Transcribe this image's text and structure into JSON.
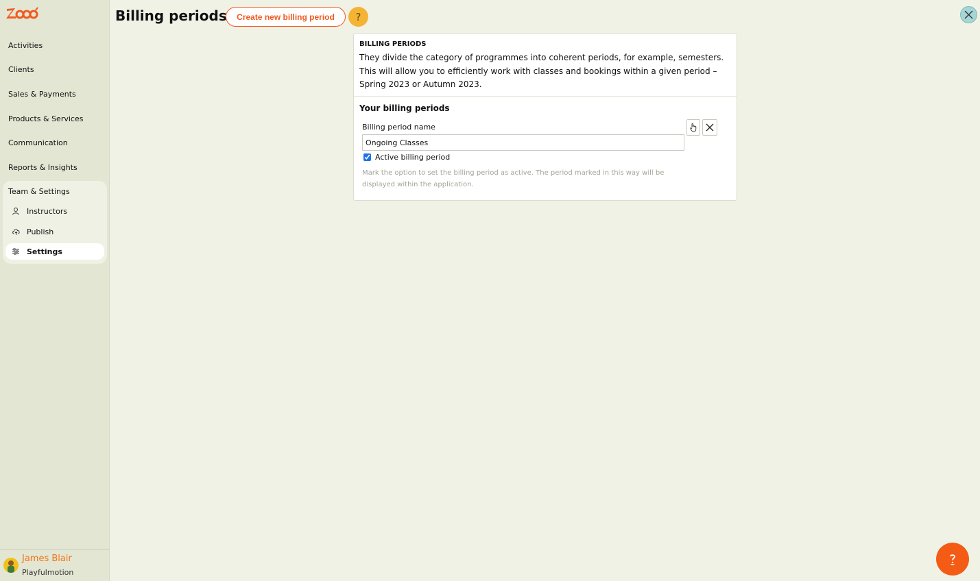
{
  "sidebar": {
    "nav": [
      {
        "label": "Activities"
      },
      {
        "label": "Clients"
      },
      {
        "label": "Sales & Payments"
      },
      {
        "label": "Products & Services"
      },
      {
        "label": "Communication"
      },
      {
        "label": "Reports & Insights"
      }
    ],
    "team": {
      "title": "Team & Settings",
      "items": [
        {
          "label": "Instructors",
          "icon": "user-icon"
        },
        {
          "label": "Publish",
          "icon": "cloud-upload-icon"
        },
        {
          "label": "Settings",
          "icon": "sliders-icon",
          "active": true
        }
      ]
    },
    "user": {
      "name": "James Blair",
      "org": "Playfulmotion"
    }
  },
  "header": {
    "title": "Billing periods",
    "create_label": "Create new billing period",
    "help_label": "?"
  },
  "card": {
    "kicker": "BILLING PERIODS",
    "description": "They divide the category of programmes into coherent periods, for example, semesters. This will allow you to efficiently work with classes and bookings within a given period – Spring 2023 or Autumn 2023.",
    "section_title": "Your billing periods",
    "field_label": "Billing period name",
    "field_value": "Ongoing Classes",
    "checkbox_label": "Active billing period",
    "checkbox_checked": true,
    "hint": "Mark the option to set the billing period as active. The period marked in this way will be displayed within the application."
  },
  "colors": {
    "accent": "#f05a22",
    "help": "#f5b335",
    "sidebar_bg": "#e3e6d3",
    "page_bg": "#f1f2e6"
  }
}
